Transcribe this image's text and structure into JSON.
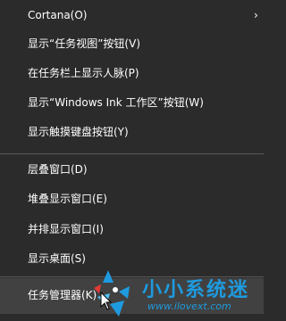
{
  "menu": {
    "items": [
      {
        "label": "Cortana(O)",
        "submenu_icon": "chevron-right-icon",
        "chevron": "›"
      },
      {
        "label": "显示“任务视图”按钮(V)"
      },
      {
        "label": "在任务栏上显示人脉(P)"
      },
      {
        "label": "显示“Windows Ink 工作区”按钮(W)"
      },
      {
        "label": "显示触摸键盘按钮(Y)"
      },
      {
        "label": "层叠窗口(D)"
      },
      {
        "label": "堆叠显示窗口(E)"
      },
      {
        "label": "并排显示窗口(I)"
      },
      {
        "label": "显示桌面(S)"
      },
      {
        "label": "任务管理器(K)",
        "highlighted": true
      }
    ]
  },
  "watermark": {
    "title": "小小系统迷",
    "url": "www.ilovext.com",
    "logo_icon": "watermark-logo-icon",
    "color": "#1e9be0"
  },
  "colors": {
    "menu_background": "#2b2b2b",
    "highlight_background": "#414141",
    "separator": "#5a5a5a",
    "text": "#ffffff"
  }
}
